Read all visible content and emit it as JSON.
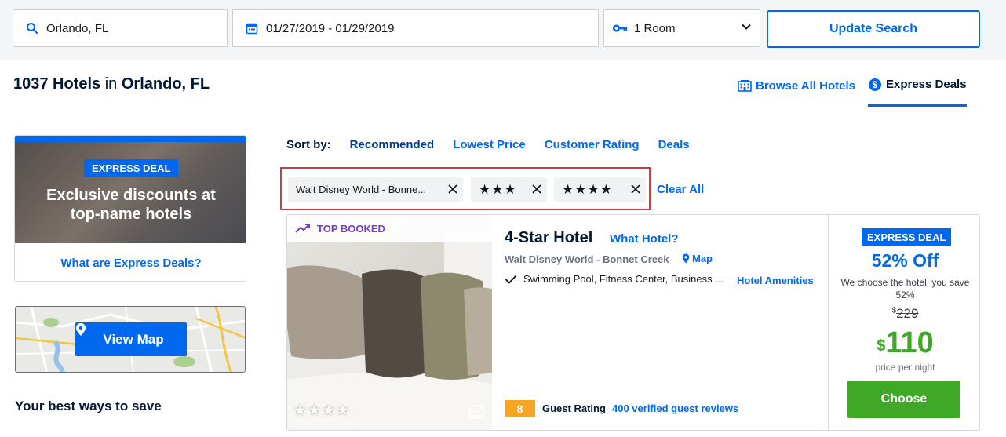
{
  "search": {
    "location": "Orlando, FL",
    "dates": "01/27/2019 - 01/29/2019",
    "rooms": "1 Room",
    "update_label": "Update Search"
  },
  "header": {
    "count": "1037 Hotels",
    "in_word": "in",
    "city": "Orlando, FL",
    "tabs": [
      {
        "label": "Browse All Hotels",
        "icon": "building-icon"
      },
      {
        "label": "Express Deals",
        "icon": "dollar-circle-icon"
      }
    ]
  },
  "promo": {
    "badge": "EXPRESS DEAL",
    "headline_1": "Exclusive discounts at",
    "headline_2": "top-name hotels",
    "link": "What are Express Deals?"
  },
  "map": {
    "button_label": "View Map"
  },
  "save_title": "Your best ways to save",
  "sort": {
    "label": "Sort by:",
    "options": [
      "Recommended",
      "Lowest Price",
      "Customer Rating",
      "Deals"
    ]
  },
  "filters": {
    "chips": [
      "Walt Disney World - Bonne...",
      "★★★",
      "★★★★"
    ],
    "clear_all": "Clear All"
  },
  "hotel": {
    "top_booked": "TOP BOOKED",
    "img_stars": "★★★★",
    "img_caption": "Actual room may vary",
    "name": "4-Star Hotel",
    "what_hotel": "What Hotel?",
    "area": "Walt Disney World - Bonnet Creek",
    "map_link": "Map",
    "amenities": "Swimming Pool, Fitness Center, Business ...",
    "amenities_link": "Hotel Amenities",
    "rating_score": "8",
    "rating_label": "Guest Rating",
    "reviews": "400 verified guest reviews",
    "deal_badge": "EXPRESS DEAL",
    "discount": "52% Off",
    "deal_desc": "We choose the hotel, you save 52%",
    "old_currency": "$",
    "old_price": "229",
    "new_currency": "$",
    "new_price": "110",
    "per_night": "price per night",
    "choose_label": "Choose"
  },
  "colors": {
    "brand_blue": "#0068ef",
    "deal_green": "#3fa827",
    "filter_highlight": "#d9383a",
    "top_booked_purple": "#7a3bd1",
    "rating_orange": "#f5a623"
  }
}
